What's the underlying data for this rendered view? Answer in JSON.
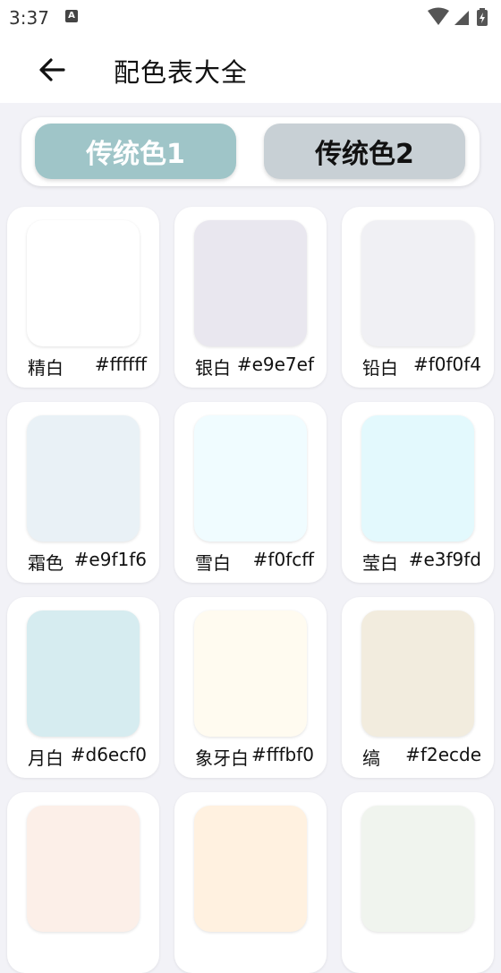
{
  "status": {
    "time": "3:37",
    "notif_letter": "A"
  },
  "appbar": {
    "title": "配色表大全"
  },
  "tabs": [
    {
      "label": "传统色1",
      "active": true
    },
    {
      "label": "传统色2",
      "active": false
    }
  ],
  "colors": [
    {
      "name": "精白",
      "hex": "#ffffff"
    },
    {
      "name": "银白",
      "hex": "#e9e7ef"
    },
    {
      "name": "铅白",
      "hex": "#f0f0f4"
    },
    {
      "name": "霜色",
      "hex": "#e9f1f6"
    },
    {
      "name": "雪白",
      "hex": "#f0fcff"
    },
    {
      "name": "莹白",
      "hex": "#e3f9fd"
    },
    {
      "name": "月白",
      "hex": "#d6ecf0"
    },
    {
      "name": "象牙白",
      "hex": "#fffbf0"
    },
    {
      "name": "缟",
      "hex": "#f2ecde"
    },
    {
      "name": "",
      "hex": "",
      "swatch": "#fcefe8"
    },
    {
      "name": "",
      "hex": "",
      "swatch": "#fff1e0"
    },
    {
      "name": "",
      "hex": "",
      "swatch": "#f0f4ee"
    }
  ]
}
